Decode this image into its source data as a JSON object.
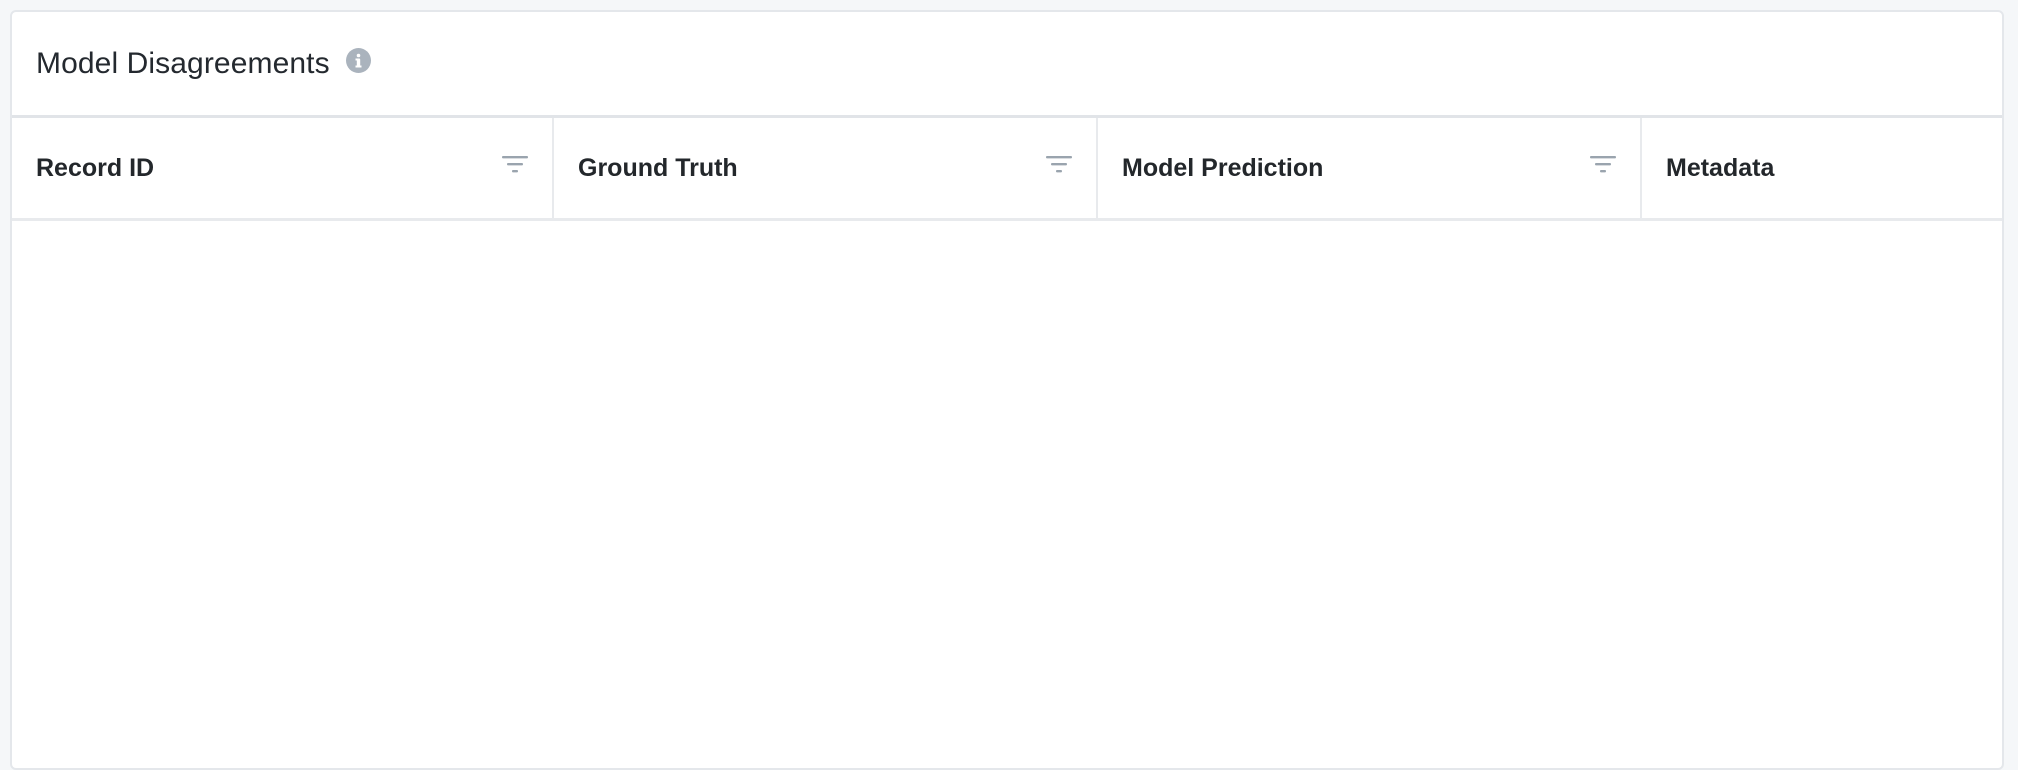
{
  "card": {
    "title": "Model Disagreements",
    "info_icon": "info-icon"
  },
  "table": {
    "columns": [
      {
        "label": "Record ID",
        "filterable": true,
        "icon": "filter-icon"
      },
      {
        "label": "Ground Truth",
        "filterable": true,
        "icon": "filter-icon"
      },
      {
        "label": "Model Prediction",
        "filterable": true,
        "icon": "filter-icon"
      },
      {
        "label": "Metadata",
        "filterable": false
      }
    ],
    "rows": []
  },
  "colors": {
    "background": "#f5f7f9",
    "card": "#ffffff",
    "border": "#e4e7eb",
    "icon_gray": "#aab3bd",
    "text": "#24292f"
  }
}
